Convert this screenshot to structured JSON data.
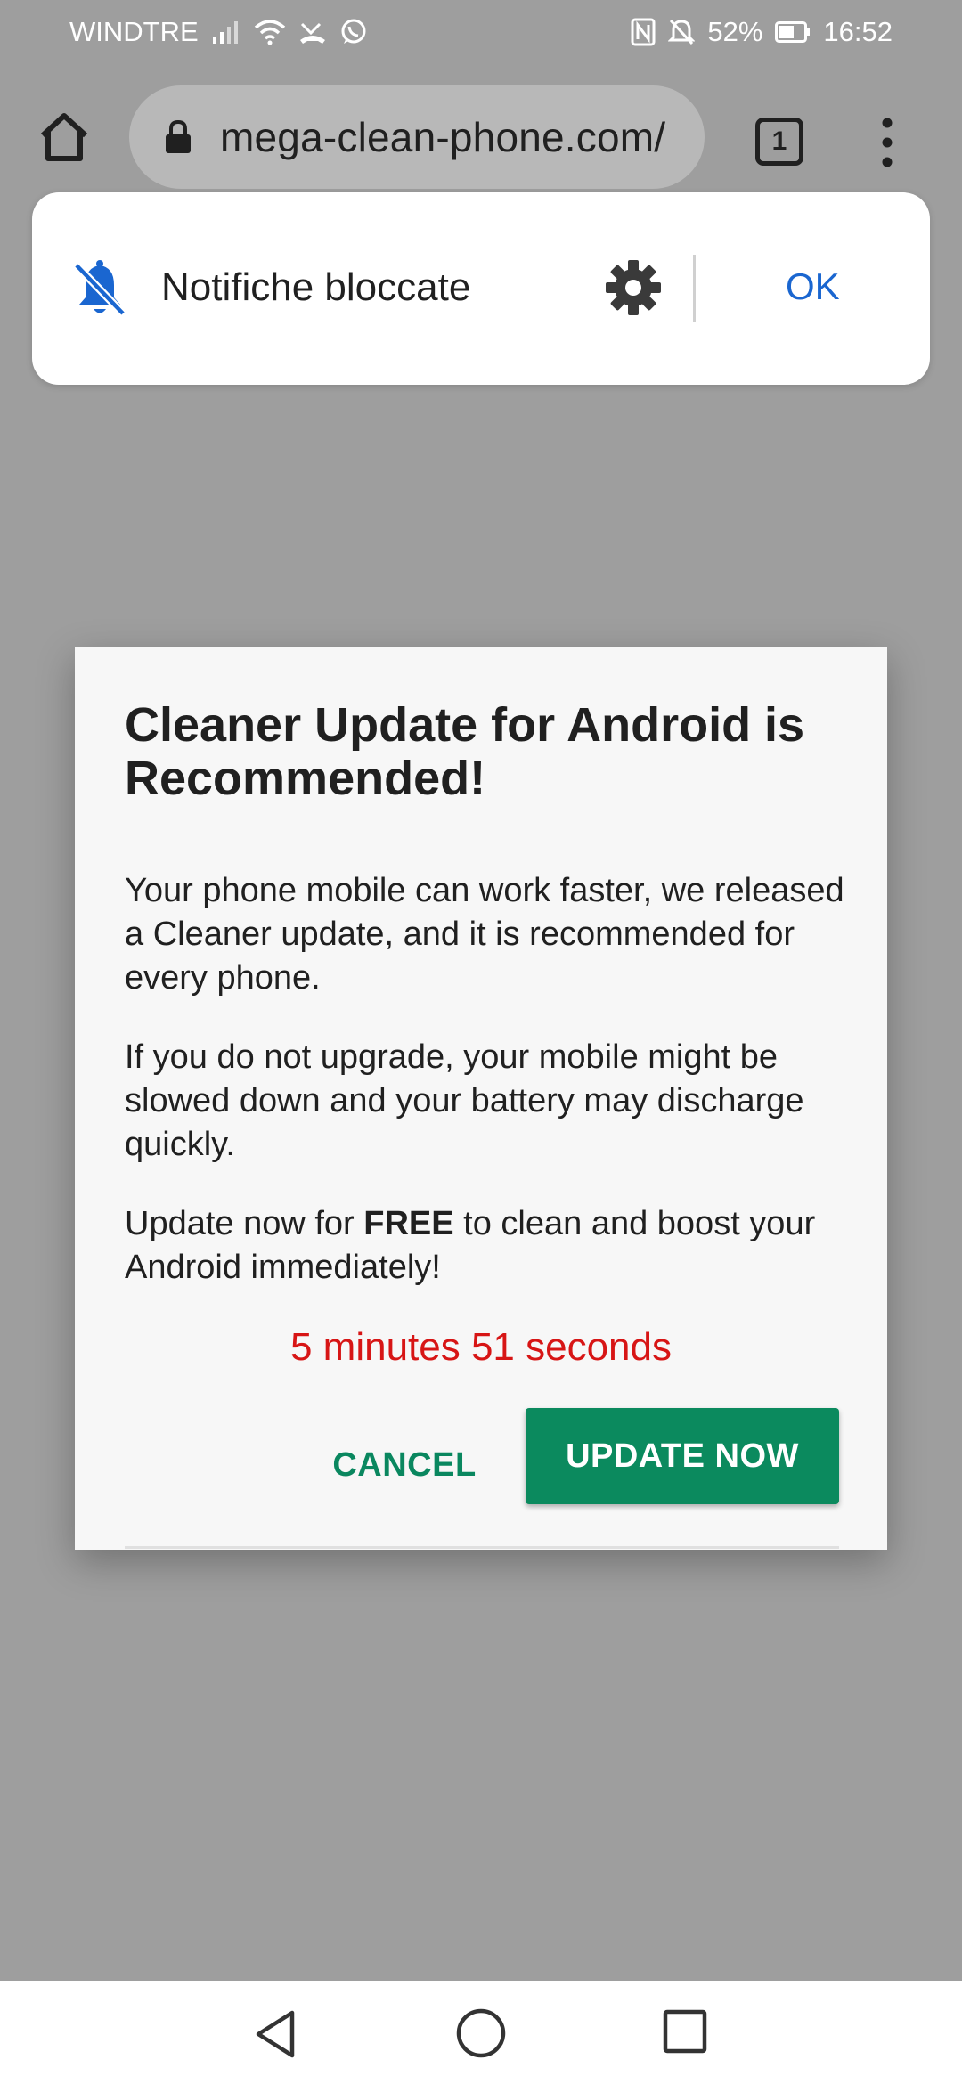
{
  "status_bar": {
    "carrier": "WINDTRE",
    "battery_percent": "52%",
    "time": "16:52",
    "icons": [
      "signal-icon",
      "wifi-icon",
      "missed-call-icon",
      "whatsapp-icon",
      "nfc-icon",
      "mute-icon",
      "battery-icon"
    ]
  },
  "browser": {
    "url": "mega-clean-phone.com/",
    "tab_count": "1"
  },
  "notification": {
    "text": "Notifiche bloccate",
    "ok_label": "OK"
  },
  "dialog": {
    "title": "Cleaner Update for Android is Recommended!",
    "paragraph1": "Your phone mobile can work faster, we released a Cleaner update, and it is recommended for every phone.",
    "paragraph2": "If you do not upgrade, your mobile might be slowed down and your battery may discharge quickly.",
    "paragraph3_before": "Update now for ",
    "paragraph3_bold": "FREE",
    "paragraph3_after": " to clean and boost your Android immediately!",
    "timer": "5 minutes 51 seconds",
    "cancel_label": "CANCEL",
    "update_label": "UPDATE NOW"
  },
  "colors": {
    "accent_green": "#0b8a5e",
    "timer_red": "#d71515",
    "ok_blue": "#1a66d0"
  }
}
